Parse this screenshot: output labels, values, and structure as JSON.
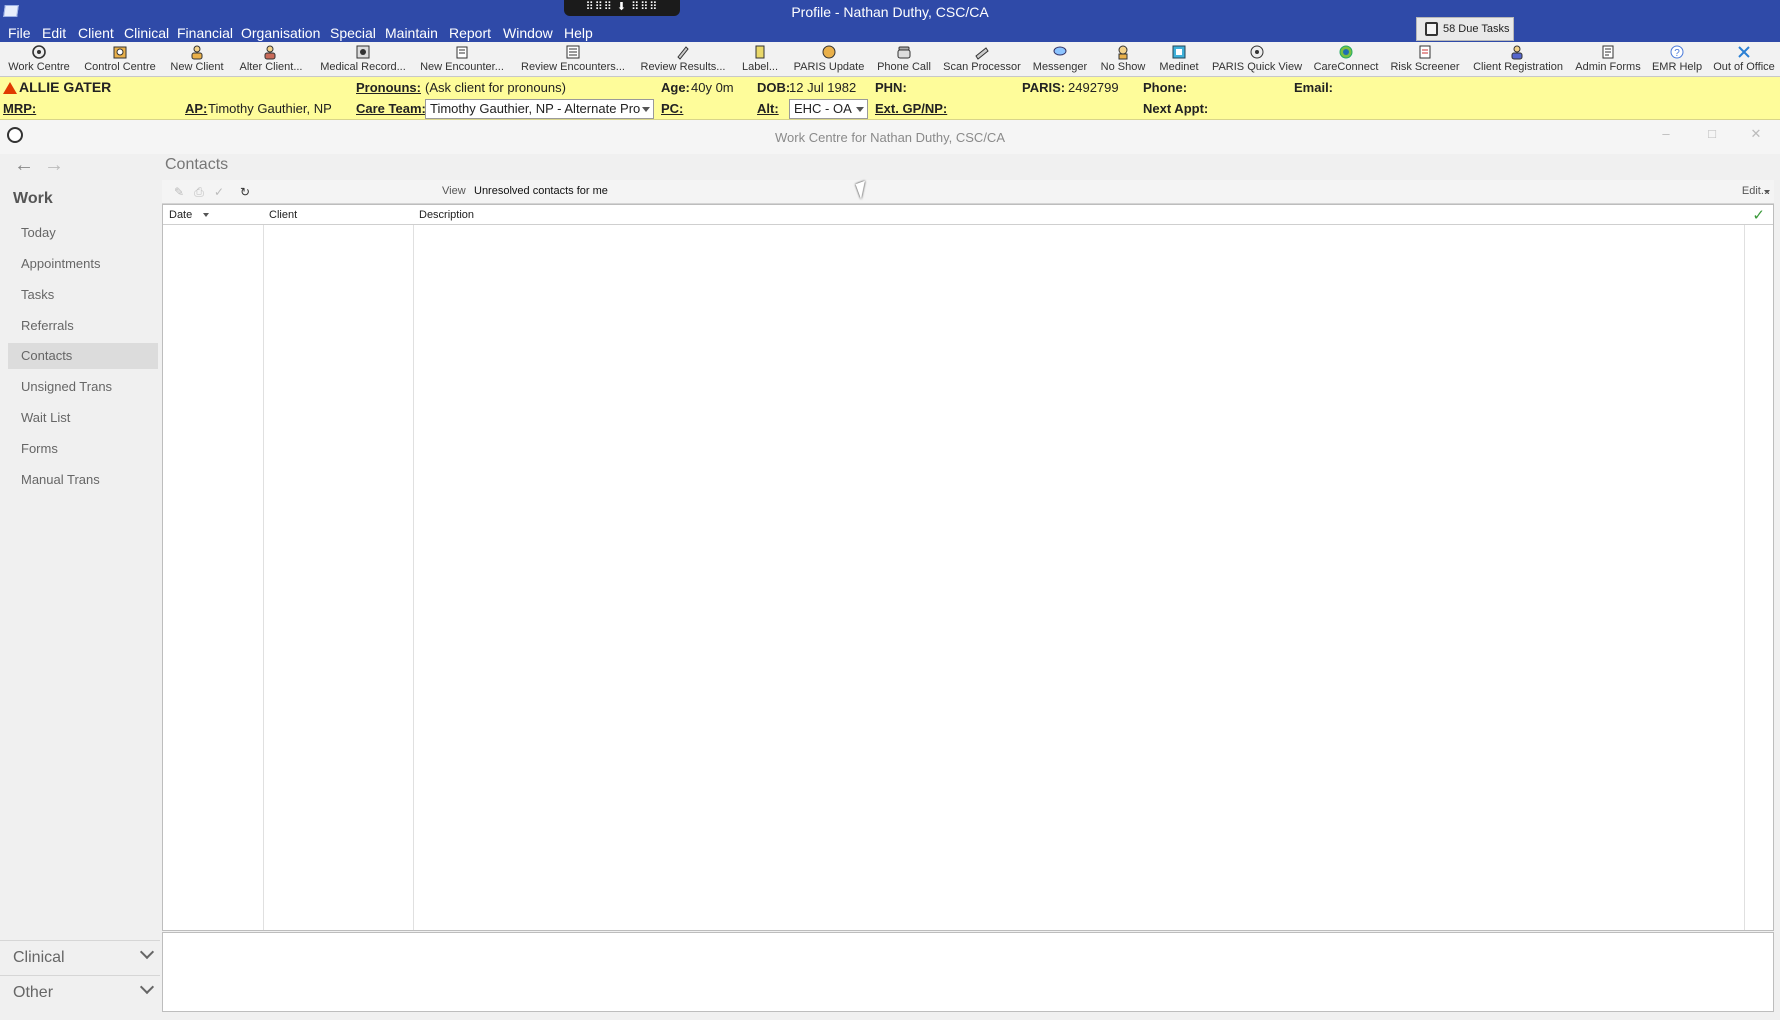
{
  "window": {
    "title": "Profile - Nathan Duthy, CSC/CA",
    "grip_label": "⠿⠿⠿ ⬇ ⠿⠿⠿"
  },
  "menu": [
    "File",
    "Edit",
    "Client",
    "Clinical",
    "Financial",
    "Organisation",
    "Special",
    "Maintain",
    "Report",
    "Window",
    "Help"
  ],
  "due_tasks": "58 Due Tasks",
  "toolbar": [
    {
      "label": "Work Centre",
      "icon": "work-centre-icon"
    },
    {
      "label": "Control Centre",
      "icon": "control-centre-icon"
    },
    {
      "label": "New Client",
      "icon": "new-client-icon"
    },
    {
      "label": "Alter Client...",
      "icon": "alter-client-icon"
    },
    {
      "label": "Medical Record...",
      "icon": "medical-record-icon"
    },
    {
      "label": "New Encounter...",
      "icon": "new-encounter-icon"
    },
    {
      "label": "Review Encounters...",
      "icon": "review-encounters-icon"
    },
    {
      "label": "Review Results...",
      "icon": "review-results-icon"
    },
    {
      "label": "Label...",
      "icon": "label-icon"
    },
    {
      "label": "PARIS Update",
      "icon": "paris-update-icon"
    },
    {
      "label": "Phone Call",
      "icon": "phone-icon"
    },
    {
      "label": "Scan Processor",
      "icon": "scanner-icon"
    },
    {
      "label": "Messenger",
      "icon": "messenger-icon"
    },
    {
      "label": "No Show",
      "icon": "no-show-icon"
    },
    {
      "label": "Medinet",
      "icon": "medinet-icon"
    },
    {
      "label": "PARIS Quick View",
      "icon": "paris-quick-view-icon"
    },
    {
      "label": "CareConnect",
      "icon": "careconnect-icon"
    },
    {
      "label": "Risk Screener",
      "icon": "risk-screener-icon"
    },
    {
      "label": "Client Registration",
      "icon": "client-registration-icon"
    },
    {
      "label": "Admin Forms",
      "icon": "admin-forms-icon"
    },
    {
      "label": "EMR Help",
      "icon": "help-icon"
    },
    {
      "label": "Out of Office",
      "icon": "out-of-office-icon"
    }
  ],
  "patient": {
    "name": "ALLIE GATER",
    "pronouns_label": "Pronouns:",
    "pronouns": "(Ask client for pronouns)",
    "age_label": "Age:",
    "age": "40y 0m",
    "dob_label": "DOB:",
    "dob": "12 Jul 1982",
    "phn_label": "PHN:",
    "paris_label": "PARIS:",
    "paris": "2492799",
    "phone_label": "Phone:",
    "email_label": "Email:",
    "mrp_label": "MRP:",
    "ap_label": "AP:",
    "ap": "Timothy Gauthier, NP",
    "care_team_label": "Care Team:",
    "care_team": "Timothy Gauthier, NP - Alternate Pro",
    "pc_label": "PC:",
    "alt_label": "Alt:",
    "alt": "EHC - OA",
    "ext_label": "Ext. GP/NP:",
    "next_appt_label": "Next Appt:"
  },
  "inner_window": {
    "title": "Work Centre for Nathan Duthy, CSC/CA"
  },
  "sidebar": {
    "heading": "Work",
    "items": [
      "Today",
      "Appointments",
      "Tasks",
      "Referrals",
      "Contacts",
      "Unsigned Trans",
      "Wait List",
      "Forms",
      "Manual Trans"
    ],
    "active": "Contacts",
    "footer": [
      "Clinical",
      "Other"
    ]
  },
  "main": {
    "section_title": "Contacts",
    "view_label": "View",
    "view_value": "Unresolved contacts for me",
    "edit_label": "Edit...",
    "columns": [
      "Date",
      "Client",
      "Description"
    ],
    "rows": []
  },
  "colors": {
    "titlebar": "#2f4aa8",
    "banner": "#fefc9a",
    "warning": "#e03a00"
  }
}
